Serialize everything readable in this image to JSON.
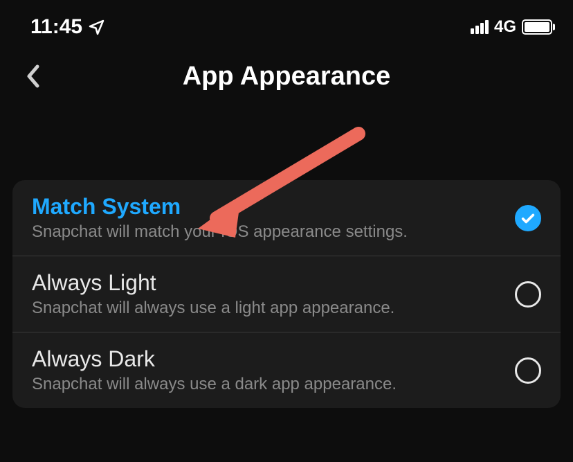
{
  "statusBar": {
    "time": "11:45",
    "networkLabel": "4G"
  },
  "header": {
    "title": "App Appearance"
  },
  "options": [
    {
      "title": "Match System",
      "subtitle": "Snapchat will match your iOS appearance settings.",
      "selected": true
    },
    {
      "title": "Always Light",
      "subtitle": "Snapchat will always use a light app appearance.",
      "selected": false
    },
    {
      "title": "Always Dark",
      "subtitle": "Snapchat will always use a dark app appearance.",
      "selected": false
    }
  ],
  "colors": {
    "accent": "#1fa9ff",
    "arrow": "#ec6a5b",
    "background": "#0d0d0d",
    "card": "#1c1c1c"
  }
}
